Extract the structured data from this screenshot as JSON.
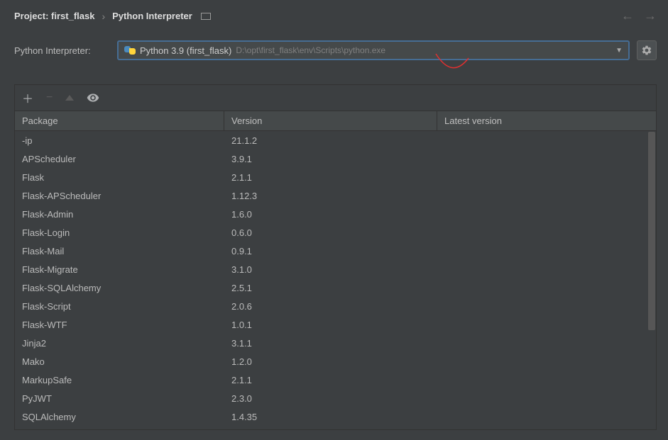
{
  "breadcrumb": {
    "prefix": "Project:",
    "project_name": "first_flask",
    "current": "Python Interpreter"
  },
  "interpreter": {
    "label": "Python Interpreter:",
    "name": "Python 3.9 (first_flask)",
    "path": "D:\\opt\\first_flask\\env\\Scripts\\python.exe"
  },
  "table": {
    "headers": {
      "package": "Package",
      "version": "Version",
      "latest": "Latest version"
    },
    "rows": [
      {
        "package": "-ip",
        "version": "21.1.2",
        "latest": ""
      },
      {
        "package": "APScheduler",
        "version": "3.9.1",
        "latest": ""
      },
      {
        "package": "Flask",
        "version": "2.1.1",
        "latest": ""
      },
      {
        "package": "Flask-APScheduler",
        "version": "1.12.3",
        "latest": ""
      },
      {
        "package": "Flask-Admin",
        "version": "1.6.0",
        "latest": ""
      },
      {
        "package": "Flask-Login",
        "version": "0.6.0",
        "latest": ""
      },
      {
        "package": "Flask-Mail",
        "version": "0.9.1",
        "latest": ""
      },
      {
        "package": "Flask-Migrate",
        "version": "3.1.0",
        "latest": ""
      },
      {
        "package": "Flask-SQLAlchemy",
        "version": "2.5.1",
        "latest": ""
      },
      {
        "package": "Flask-Script",
        "version": "2.0.6",
        "latest": ""
      },
      {
        "package": "Flask-WTF",
        "version": "1.0.1",
        "latest": ""
      },
      {
        "package": "Jinja2",
        "version": "3.1.1",
        "latest": ""
      },
      {
        "package": "Mako",
        "version": "1.2.0",
        "latest": ""
      },
      {
        "package": "MarkupSafe",
        "version": "2.1.1",
        "latest": ""
      },
      {
        "package": "PyJWT",
        "version": "2.3.0",
        "latest": ""
      },
      {
        "package": "SQLAlchemy",
        "version": "1.4.35",
        "latest": ""
      }
    ]
  }
}
